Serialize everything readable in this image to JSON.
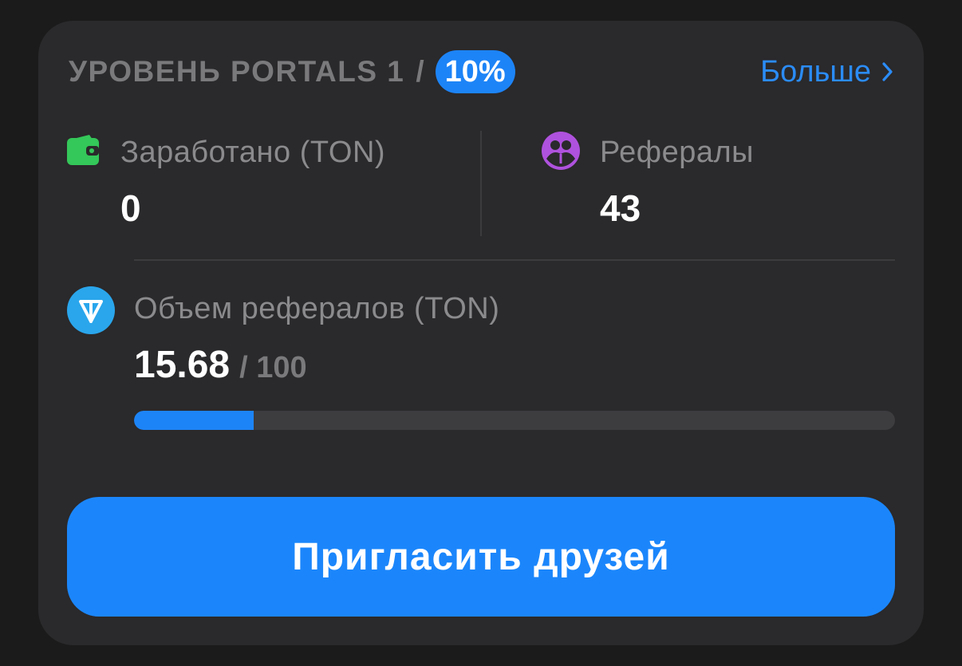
{
  "header": {
    "level_label": "УРОВЕНЬ PORTALS 1",
    "separator": "/",
    "percent_badge": "10%",
    "more_link": "Больше"
  },
  "stats": {
    "earned": {
      "label": "Заработано (TON)",
      "value": "0",
      "icon": "wallet-icon",
      "color": "#34c759"
    },
    "referrals": {
      "label": "Рефералы",
      "value": "43",
      "icon": "people-icon",
      "color": "#af52de"
    }
  },
  "volume": {
    "label": "Объем рефералов (TON)",
    "value": "15.68",
    "max_label": "/ 100",
    "progress_fraction": 0.1568,
    "icon": "ton-icon",
    "color": "#2aa6ec"
  },
  "invite_button": {
    "label": "Пригласить друзей"
  },
  "colors": {
    "accent": "#1d84f7",
    "card_bg": "#2a292b",
    "page_bg": "#1b1b1b"
  }
}
